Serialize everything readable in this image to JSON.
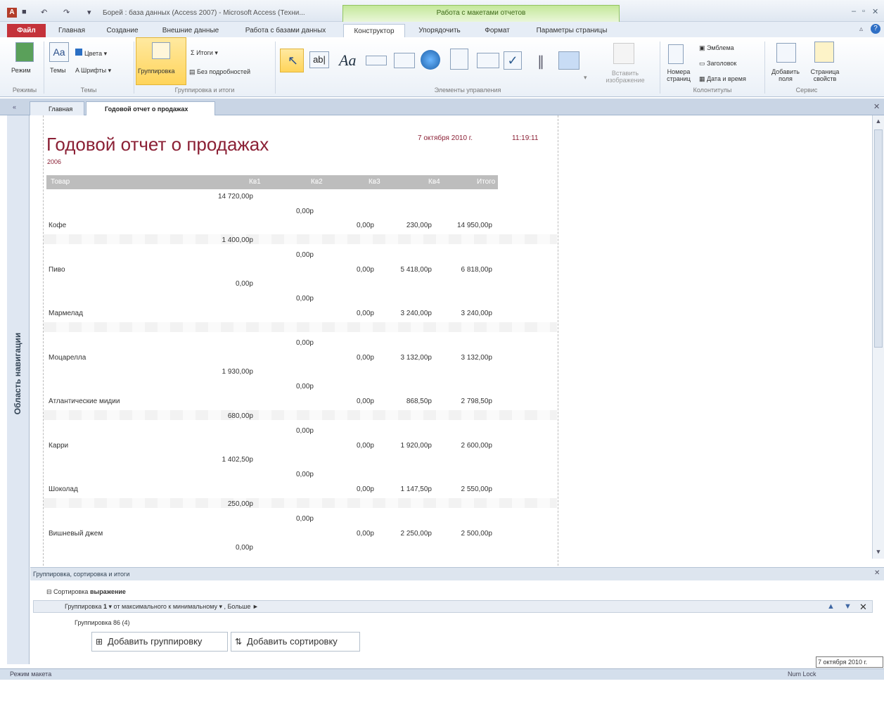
{
  "window": {
    "title": "Борей : база данных (Access 2007) - Microsoft Access (Техни...",
    "context_tab_title": "Работа с макетами отчетов"
  },
  "ribbon": {
    "tabs": [
      {
        "label": "Файл"
      },
      {
        "label": "Главная"
      },
      {
        "label": "Создание"
      },
      {
        "label": "Внешние данные"
      },
      {
        "label": "Работа с базами данных"
      },
      {
        "label": "Конструктор"
      },
      {
        "label": "Упорядочить"
      },
      {
        "label": "Формат"
      },
      {
        "label": "Параметры страницы"
      }
    ],
    "view_btn": "Режим",
    "themes_btn": "Темы",
    "colors_btn": "Цвета",
    "fonts_btn": "Шрифты",
    "grouping_btn": "Группировка",
    "totals_btn": "Итоги",
    "hide_details_btn": "Без подробностей",
    "insert_image_btn": "Вставить изображение",
    "page_numbers_btn": "Номера страниц",
    "logo_btn": "Эмблема",
    "title_btn": "Заголовок",
    "datetime_btn": "Дата и время",
    "add_fields_btn": "Добавить поля",
    "property_sheet_btn": "Страница свойств",
    "groups": [
      "Режимы",
      "Темы",
      "Группировка и итоги",
      "Элементы управления",
      "Колонтитулы",
      "Сервис"
    ]
  },
  "doctabs": [
    "Главная",
    "Годовой отчет о продажах"
  ],
  "nav": {
    "label": "Область навигации"
  },
  "report": {
    "title": "Годовой отчет о продажах",
    "year": "2006",
    "date": "7 октября 2010 г.",
    "time": "11:19:11",
    "header_cols": [
      "Товар",
      "Кв1",
      "Кв2",
      "Кв3",
      "Кв4",
      "Итого"
    ],
    "first_value": "14 720,00р",
    "rows": [
      {
        "pre": "0,00р",
        "name": "Кофе",
        "q3": "0,00р",
        "q4": "230,00р",
        "total": "14 950,00р",
        "post": "1 400,00р"
      },
      {
        "pre": "0,00р",
        "name": "Пиво",
        "q3": "0,00р",
        "q4": "5 418,00р",
        "total": "6 818,00р",
        "post": "0,00р"
      },
      {
        "pre": "0,00р",
        "name": "Мармелад",
        "q3": "0,00р",
        "q4": "3 240,00р",
        "total": "3 240,00р",
        "post": ""
      },
      {
        "pre": "0,00р",
        "name": "Моцарелла",
        "q3": "0,00р",
        "q4": "3 132,00р",
        "total": "3 132,00р",
        "post": "1 930,00р"
      },
      {
        "pre": "0,00р",
        "name": "Атлантические мидии",
        "q3": "0,00р",
        "q4": "868,50р",
        "total": "2 798,50р",
        "post": "680,00р"
      },
      {
        "pre": "0,00р",
        "name": "Карри",
        "q3": "0,00р",
        "q4": "1 920,00р",
        "total": "2 600,00р",
        "post": "1 402,50р"
      },
      {
        "pre": "0,00р",
        "name": "Шоколад",
        "q3": "0,00р",
        "q4": "1 147,50р",
        "total": "2 550,00р",
        "post": "250,00р"
      },
      {
        "pre": "0,00р",
        "name": "Вишневый джем",
        "q3": "0,00р",
        "q4": "2 250,00р",
        "total": "2 500,00р",
        "post": "0,00р"
      }
    ]
  },
  "grouping": {
    "header": "Группировка, сортировка и итоги",
    "sort_label": "Сортировка",
    "sort_field": "выражение",
    "group_label": "Группировка",
    "group_value": "1",
    "group_order": "от максимального к минимальному",
    "group_more": "Больше",
    "group2": "Группировка 86 (4)",
    "add_group": "Добавить группировку",
    "add_sort": "Добавить сортировку"
  },
  "status": {
    "left": "Режим макета",
    "right": "Num Lock"
  },
  "tooltip": "7 октября 2010 г."
}
